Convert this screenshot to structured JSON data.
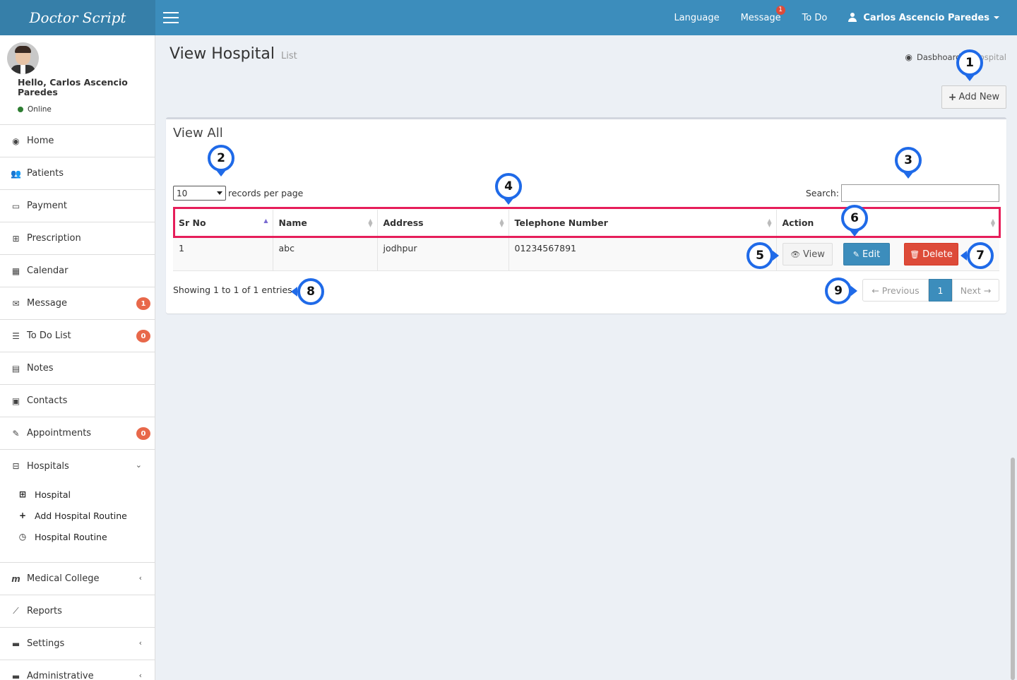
{
  "app": {
    "logo": "Doctor Script"
  },
  "topnav": {
    "language": "Language",
    "message": "Message",
    "message_badge": "1",
    "todo": "To Do",
    "user": "Carlos Ascencio Paredes"
  },
  "sidebar": {
    "greeting": "Hello, Carlos Ascencio Paredes",
    "status": "Online",
    "items": [
      {
        "label": "Home",
        "icon": "dashboard-icon"
      },
      {
        "label": "Patients",
        "icon": "users-icon"
      },
      {
        "label": "Payment",
        "icon": "credit-card-icon"
      },
      {
        "label": "Prescription",
        "icon": "medkit-icon"
      },
      {
        "label": "Calendar",
        "icon": "calendar-icon"
      },
      {
        "label": "Message",
        "icon": "envelope-icon",
        "badge": "1"
      },
      {
        "label": "To Do List",
        "icon": "list-icon",
        "badge": "0"
      },
      {
        "label": "Notes",
        "icon": "file-icon"
      },
      {
        "label": "Contacts",
        "icon": "address-card-icon"
      },
      {
        "label": "Appointments",
        "icon": "pin-icon",
        "badge": "0"
      },
      {
        "label": "Hospitals",
        "icon": "hospital-icon"
      },
      {
        "label": "Medical College",
        "icon": "m-icon"
      },
      {
        "label": "Reports",
        "icon": "line-chart-icon"
      },
      {
        "label": "Settings",
        "icon": "folder-icon"
      },
      {
        "label": "Administrative",
        "icon": "folder-icon"
      }
    ],
    "submenu": [
      {
        "label": "Hospital",
        "icon": "hospital-icon"
      },
      {
        "label": "Add Hospital Routine",
        "icon": "plus-icon"
      },
      {
        "label": "Hospital Routine",
        "icon": "clock-icon"
      }
    ]
  },
  "page": {
    "title": "View Hospital",
    "subtitle": "List",
    "breadcrumb_home": "Dasbhoard",
    "breadcrumb_current": "Hospital",
    "add_new": "Add New"
  },
  "box": {
    "title": "View All",
    "length_value": "10",
    "length_label": "records per page",
    "search_label": "Search:",
    "columns": [
      "Sr No",
      "Name",
      "Address",
      "Telephone Number",
      "Action"
    ],
    "rows": [
      {
        "sr": "1",
        "name": "abc",
        "address": "jodhpur",
        "phone": "01234567891"
      }
    ],
    "actions": {
      "view": "View",
      "edit": "Edit",
      "delete": "Delete"
    },
    "info": "Showing 1 to 1 of 1 entries",
    "pager": {
      "prev": "← Previous",
      "page": "1",
      "next": "Next →"
    }
  },
  "callouts": [
    "1",
    "2",
    "3",
    "4",
    "5",
    "6",
    "7",
    "8",
    "9"
  ],
  "colors": {
    "topbar": "#3c8dbc",
    "logo_bg": "#367fa9",
    "callout": "#1f6ae8",
    "highlight": "#e61e5a",
    "danger": "#dd4b39"
  }
}
